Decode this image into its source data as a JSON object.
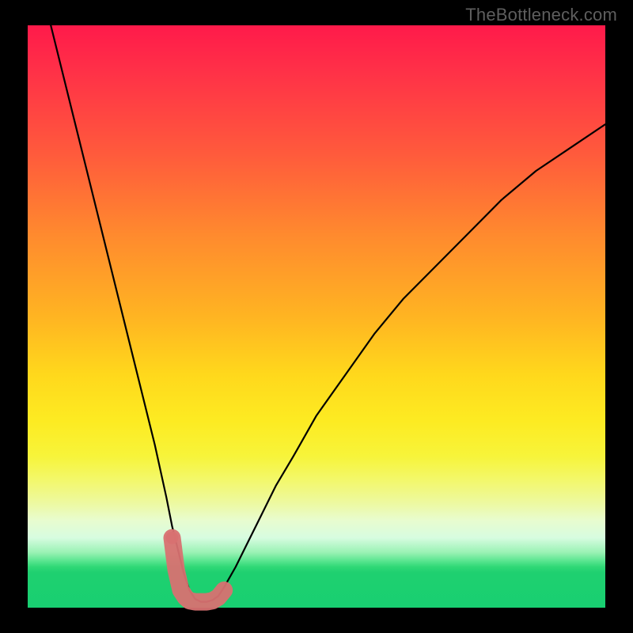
{
  "watermark": "TheBottleneck.com",
  "chart_data": {
    "type": "line",
    "title": "",
    "xlabel": "",
    "ylabel": "",
    "xlim": [
      0,
      100
    ],
    "ylim": [
      0,
      100
    ],
    "grid": false,
    "series": [
      {
        "name": "bottleneck-curve",
        "color": "#000000",
        "x": [
          4,
          6,
          8,
          10,
          12,
          14,
          16,
          18,
          20,
          22,
          24,
          25,
          26,
          27,
          28,
          29,
          30,
          31,
          32,
          33,
          34,
          36,
          38,
          40,
          43,
          46,
          50,
          55,
          60,
          65,
          70,
          76,
          82,
          88,
          94,
          100
        ],
        "y": [
          100,
          92,
          84,
          76,
          68,
          60,
          52,
          44,
          36,
          28,
          19,
          14,
          10,
          6,
          3,
          1.5,
          1,
          1,
          1.3,
          2,
          3.5,
          7,
          11,
          15,
          21,
          26,
          33,
          40,
          47,
          53,
          58,
          64,
          70,
          75,
          79,
          83
        ]
      },
      {
        "name": "highlight-band",
        "color": "#d87171",
        "x": [
          25.0,
          25.7,
          26.5,
          27.3,
          28.0,
          29.0,
          30.0,
          31.0,
          32.0,
          33.0,
          34.0
        ],
        "y": [
          12.0,
          6.5,
          3.0,
          1.8,
          1.2,
          1.0,
          1.0,
          1.0,
          1.2,
          1.8,
          3.0
        ]
      }
    ],
    "highlight_points": [
      {
        "x": 25.0,
        "y": 12.0
      }
    ],
    "gradient_stops": [
      {
        "pct": 0,
        "color": "#ff1a4a"
      },
      {
        "pct": 50,
        "color": "#ffd81c"
      },
      {
        "pct": 78,
        "color": "#f3f86a"
      },
      {
        "pct": 92,
        "color": "#58e58f"
      },
      {
        "pct": 100,
        "color": "#18cf71"
      }
    ]
  }
}
